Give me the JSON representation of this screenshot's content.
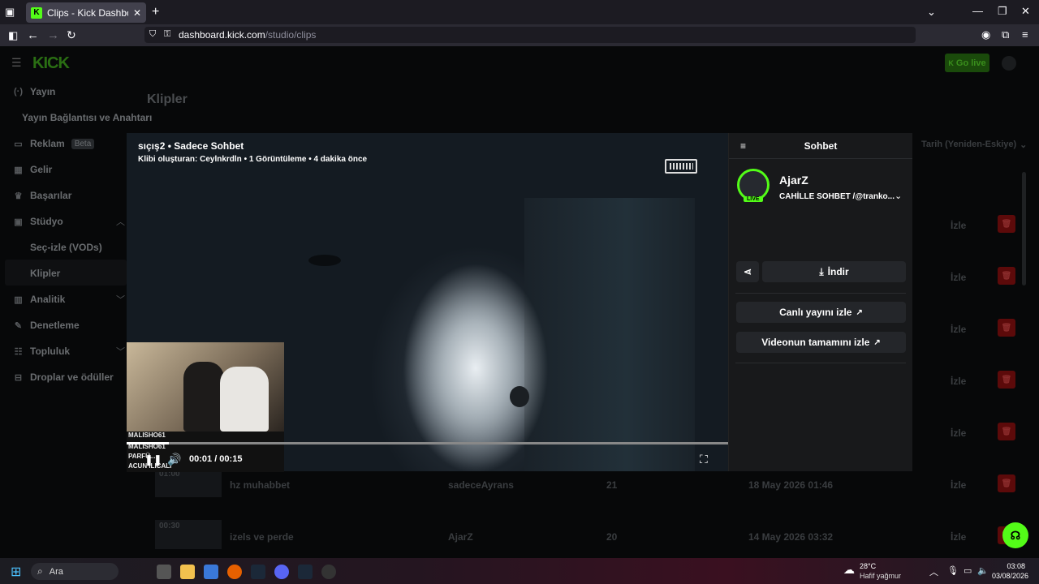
{
  "browser": {
    "tab_title": "Clips - Kick Dashboard",
    "url_host": "dashboard.kick.com",
    "url_path": "/studio/clips"
  },
  "app": {
    "logo": "KICK",
    "go_live": "Go live",
    "page_title": "Klipler",
    "sort_label": "Tarih (Yeniden-Eskiye)",
    "sidebar": [
      {
        "label": "Yayın",
        "icon": "broadcast-icon"
      },
      {
        "label": "Yayın Bağlantısı ve Anahtarı",
        "icon": ""
      },
      {
        "label": "Reklam",
        "badge": "Beta",
        "icon": "ad-icon"
      },
      {
        "label": "Gelir",
        "icon": "revenue-icon"
      },
      {
        "label": "Başarılar",
        "icon": "trophy-icon"
      },
      {
        "label": "Stüdyo",
        "icon": "studio-icon"
      },
      {
        "label": "Seç-izle (VODs)",
        "icon": ""
      },
      {
        "label": "Klipler",
        "icon": ""
      },
      {
        "label": "Analitik",
        "icon": "analytics-icon"
      },
      {
        "label": "Denetleme",
        "icon": "wrench-icon"
      },
      {
        "label": "Topluluk",
        "icon": "community-icon"
      },
      {
        "label": "Droplar ve ödüller",
        "icon": "drops-icon"
      }
    ],
    "rows": [
      {
        "watch": "İzle"
      },
      {
        "watch": "İzle"
      },
      {
        "watch": "İzle"
      },
      {
        "watch": "İzle"
      },
      {
        "watch": "İzle"
      },
      {
        "duration": "01:00",
        "title": "hz muhabbet",
        "creator": "sadeceAyrans",
        "views": "21",
        "date": "18 May 2026 01:46",
        "watch": "İzle"
      },
      {
        "duration": "00:30",
        "title": "izels ve perde",
        "creator": "AjarZ",
        "views": "20",
        "date": "14 May 2026 03:32",
        "watch": "İzle"
      }
    ]
  },
  "modal": {
    "clip_title": "sıçış2 • Sadece Sohbet",
    "clip_meta": "Klibi oluşturan: Ceylnkrdln • 1 Görüntüleme • 4 dakika önce",
    "time": "00:01 / 00:15",
    "progress_fraction": 0.07,
    "webcam_overlay": [
      "MALISHO61",
      "MALISHO61",
      "PARFÜ...",
      "ACUN ILICALI"
    ],
    "chat": {
      "header": "Sohbet",
      "channel_name": "AjarZ",
      "stream_title": "CAHİLLE SOHBET /@tranko...",
      "live_label": "LIVE",
      "download": "İndir",
      "watch_live": "Canlı yayını izle",
      "watch_full": "Videonun tamamını izle"
    }
  },
  "taskbar": {
    "search": "Ara",
    "weather_temp": "28°C",
    "weather_desc": "Hafif yağmur",
    "time": "03:08",
    "date": "03/08/2026"
  },
  "colors": {
    "accent": "#53fc18",
    "danger": "#5c0a0a"
  }
}
